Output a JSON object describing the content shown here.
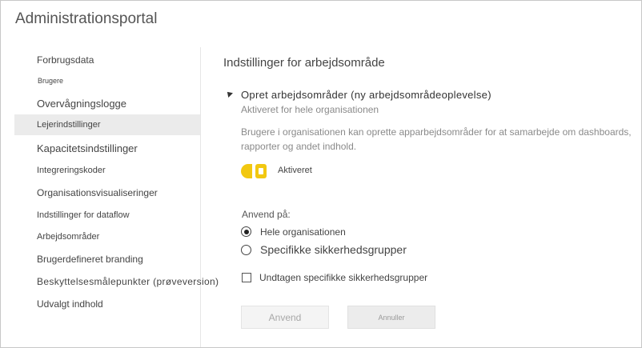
{
  "app": {
    "title": "Administrationsportal"
  },
  "sidebar": {
    "items": [
      {
        "label": "Forbrugsdata"
      },
      {
        "label": "Brugere"
      },
      {
        "label": "Overvågningslogge"
      },
      {
        "label": "Lejerindstillinger",
        "active": true
      },
      {
        "label": "Kapacitetsindstillinger"
      },
      {
        "label": "Integreringskoder"
      },
      {
        "label": "Organisationsvisualiseringer"
      },
      {
        "label": "Indstillinger for dataflow"
      },
      {
        "label": "Arbejdsområder"
      },
      {
        "label": "Brugerdefineret branding"
      },
      {
        "label": "Beskyttelsesmålepunkter (prøveversion)"
      },
      {
        "label": "Udvalgt indhold"
      }
    ]
  },
  "main": {
    "section_title": "Indstillinger for arbejdsområde",
    "setting": {
      "name": "Opret arbejdsområder (ny arbejdsområdeoplevelse)",
      "status": "Aktiveret for hele organisationen",
      "description": "Brugere i organisationen kan oprette apparbejdsområder for at samarbejde om dashboards, rapporter og andet indhold.",
      "toggle": {
        "label": "Aktiveret",
        "on": true,
        "color": "#f2c811"
      },
      "apply_to": {
        "label": "Anvend på:",
        "options": [
          {
            "label": "Hele organisationen",
            "selected": true
          },
          {
            "label": "Specifikke sikkerhedsgrupper",
            "selected": false
          }
        ]
      },
      "exception": {
        "label": "Undtagen specifikke sikkerhedsgrupper",
        "checked": false
      }
    },
    "buttons": {
      "apply_label": "Anvend",
      "cancel_label": "Annuller"
    }
  }
}
